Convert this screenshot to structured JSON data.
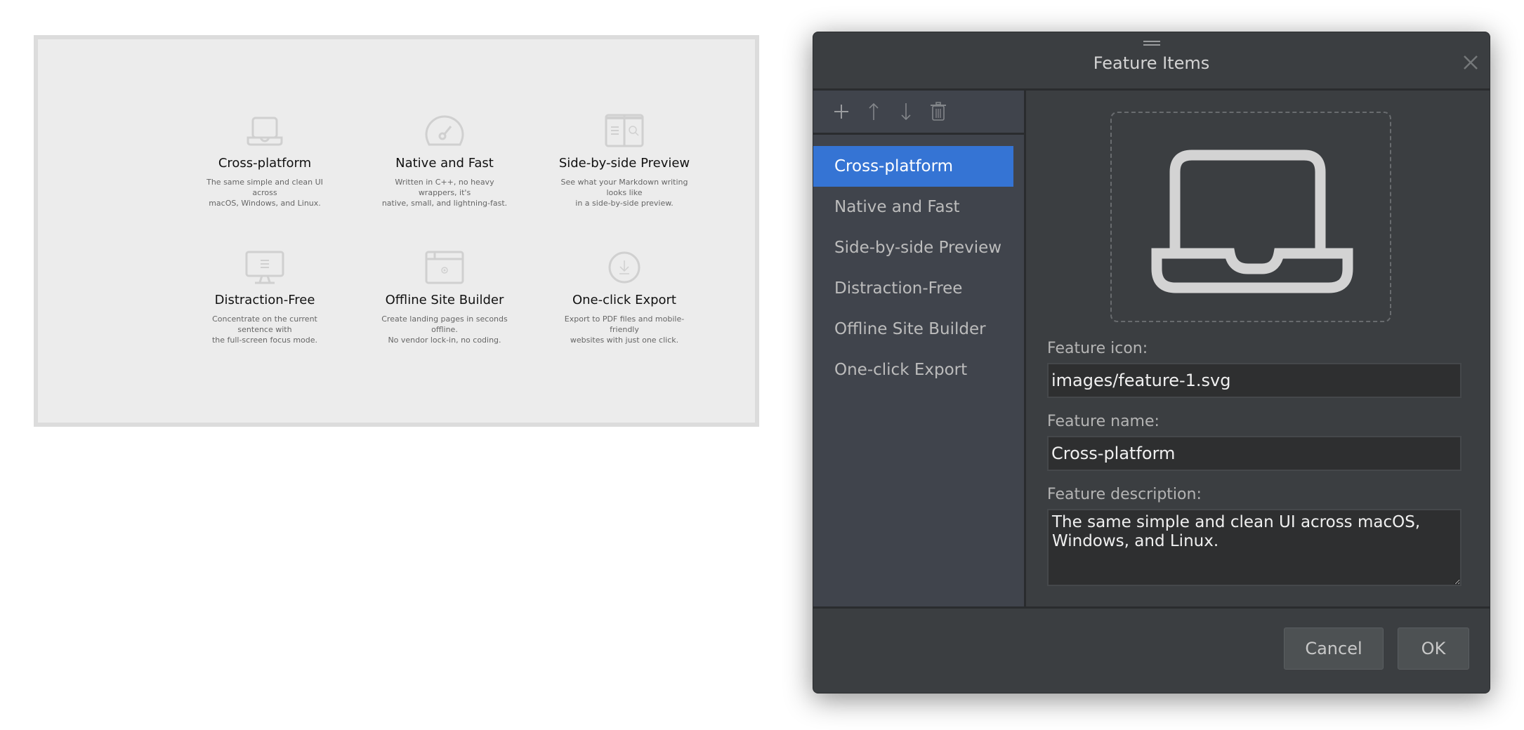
{
  "preview": {
    "features": [
      {
        "icon": "laptop-icon",
        "title": "Cross-platform",
        "desc_lines": [
          "The same simple and clean UI across",
          "macOS, Windows, and Linux."
        ]
      },
      {
        "icon": "speedometer-icon",
        "title": "Native and Fast",
        "desc_lines": [
          "Written in C++, no heavy wrappers, it's",
          "native, small, and lightning-fast."
        ]
      },
      {
        "icon": "split-preview-icon",
        "title": "Side-by-side Preview",
        "desc_lines": [
          "See what your Markdown writing looks like",
          "in a side-by-side preview."
        ]
      },
      {
        "icon": "monitor-icon",
        "title": "Distraction-Free",
        "desc_lines": [
          "Concentrate on the current sentence with",
          "the full-screen focus mode."
        ]
      },
      {
        "icon": "browser-gear-icon",
        "title": "Offline Site Builder",
        "desc_lines": [
          "Create landing pages in seconds offline.",
          "No vendor lock-in, no coding."
        ]
      },
      {
        "icon": "download-circle-icon",
        "title": "One-click Export",
        "desc_lines": [
          "Export to PDF files and mobile-friendly",
          "websites with just one click."
        ]
      }
    ]
  },
  "dialog": {
    "title": "Feature Items",
    "toolbar": {
      "add": "plus-icon",
      "move_up": "arrow-up-icon",
      "move_down": "arrow-down-icon",
      "delete": "trash-icon"
    },
    "list": {
      "selected_index": 0,
      "items": [
        "Cross-platform",
        "Native and Fast",
        "Side-by-side Preview",
        "Distraction-Free",
        "Offline Site Builder",
        "One-click Export"
      ]
    },
    "form": {
      "icon_label": "Feature icon:",
      "icon_value": "images/feature-1.svg",
      "name_label": "Feature name:",
      "name_value": "Cross-platform",
      "desc_label": "Feature description:",
      "desc_value": "The same simple and clean UI across macOS, Windows, and Linux."
    },
    "buttons": {
      "cancel": "Cancel",
      "ok": "OK"
    },
    "colors": {
      "accent": "#3574d4",
      "dialog_bg": "#3b3e41",
      "sidebar_bg": "#40444c"
    }
  }
}
